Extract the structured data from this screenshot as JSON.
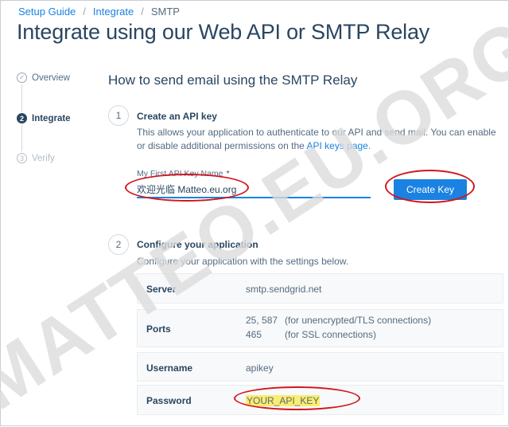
{
  "breadcrumb": {
    "items": [
      "Setup Guide",
      "Integrate"
    ],
    "separator": "/",
    "current": "SMTP"
  },
  "page_title": "Integrate using our Web API or SMTP Relay",
  "stepper": {
    "steps": [
      {
        "label": "Overview",
        "mark": "✓",
        "state": "done"
      },
      {
        "label": "Integrate",
        "mark": "2",
        "state": "active"
      },
      {
        "label": "Verify",
        "mark": "3",
        "state": "todo"
      }
    ]
  },
  "section_title": "How to send email using the SMTP Relay",
  "step1": {
    "number": "1",
    "title": "Create an API key",
    "desc_before": "This allows your application to authenticate to our API and send mail. You can enable or disable additional permissions on the ",
    "desc_link": "API keys page",
    "desc_after": ".",
    "field_label": "My First API Key Name",
    "field_required_mark": "*",
    "field_value": "欢迎光临 Matteo.eu.org",
    "button_label": "Create Key"
  },
  "step2": {
    "number": "2",
    "title": "Configure your application",
    "desc": "Configure your application with the settings below."
  },
  "settings": {
    "server_label": "Server",
    "server_value": "smtp.sendgrid.net",
    "ports_label": "Ports",
    "ports": [
      {
        "value": "25, 587",
        "note": "(for unencrypted/TLS connections)"
      },
      {
        "value": "465",
        "note": "(for SSL connections)"
      }
    ],
    "username_label": "Username",
    "username_value": "apikey",
    "password_label": "Password",
    "password_value": "YOUR_API_KEY"
  },
  "watermark": "MATTEO.EU.ORG",
  "colors": {
    "accent": "#1a82e2",
    "annotation": "#d3161d",
    "highlight": "#fbed6e",
    "text": "#294661"
  }
}
